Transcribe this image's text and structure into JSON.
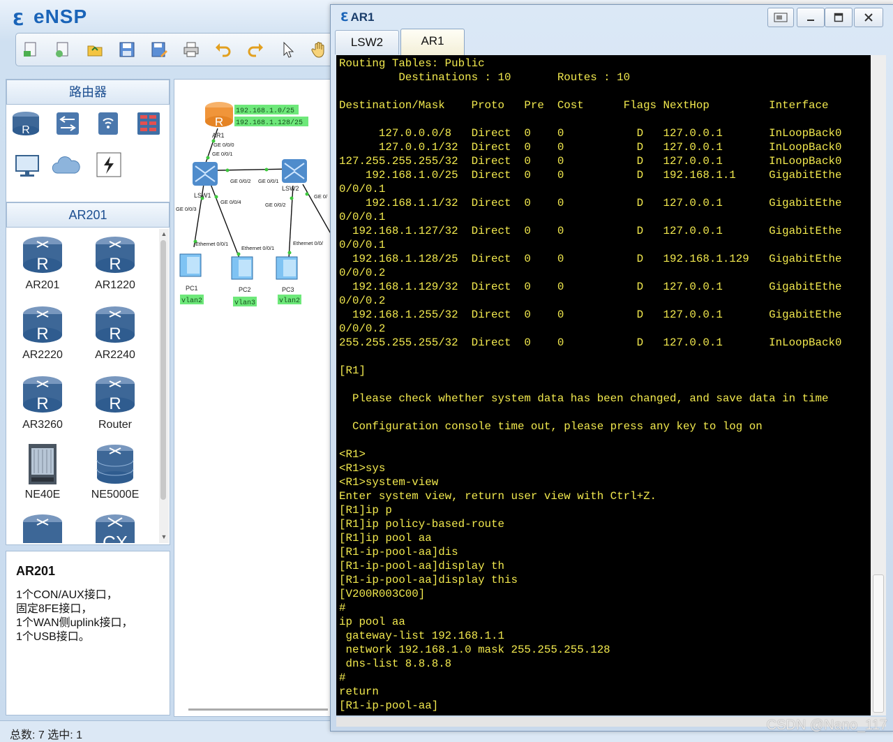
{
  "app": {
    "title": "eNSP"
  },
  "toolbar": {
    "buttons": [
      "new-topology-icon",
      "new-example-icon",
      "open-icon",
      "save-icon",
      "save-as-icon",
      "print-icon",
      "undo-icon",
      "redo-icon",
      "select-icon",
      "pan-hand-icon"
    ]
  },
  "left_panel": {
    "category_header": "路由器",
    "category_icons": [
      "router-category-icon",
      "switch-category-icon",
      "wireless-category-icon",
      "firewall-category-icon",
      "pc-category-icon",
      "cloud-category-icon",
      "connection-category-icon"
    ],
    "device_header": "AR201",
    "devices": [
      {
        "label": "AR201",
        "icon": "router-icon"
      },
      {
        "label": "AR1220",
        "icon": "router-icon"
      },
      {
        "label": "AR2220",
        "icon": "router-icon"
      },
      {
        "label": "AR2240",
        "icon": "router-icon"
      },
      {
        "label": "AR3260",
        "icon": "router-icon"
      },
      {
        "label": "Router",
        "icon": "router-icon"
      },
      {
        "label": "NE40E",
        "icon": "chassis-icon"
      },
      {
        "label": "NE5000E",
        "icon": "router-stack-icon"
      }
    ],
    "description": {
      "title": "AR201",
      "lines": [
        "1个CON/AUX接口，",
        "固定8FE接口，",
        "1个WAN侧uplink接口，",
        "1个USB接口。"
      ]
    }
  },
  "topology": {
    "nodes": {
      "ar1": "AR1",
      "lsw1": "LSW1",
      "lsw2": "LSW2",
      "pc1": "PC1",
      "pc2": "PC2",
      "pc3": "PC3"
    },
    "ip_labels": [
      "192.168.1.0/25",
      "192.168.1.128/25"
    ],
    "port_labels": {
      "ar1_ge000": "GE 0/0/0",
      "lsw1_ge001": "GE 0/0/1",
      "lsw1_ge002": "GE 0/0/2",
      "lsw2_ge001": "GE 0/0/1",
      "lsw1_ge003": "GE 0/0/3",
      "lsw1_ge004": "GE 0/0/4",
      "lsw2_ge002": "GE 0/0/2",
      "lsw2_ge0": "GE 0/",
      "pc1_eth": "Ethernet 0/0/1",
      "pc2_eth": "Ethernet 0/0/1",
      "pc3_eth": "Ethernet 0/0/"
    },
    "vlan_labels": {
      "pc1": "vlan2",
      "pc2": "vlan3",
      "pc3": "vlan2"
    }
  },
  "status_bar": {
    "text": "总数: 7 选中: 1"
  },
  "watermark": "CSDN @Nano_117",
  "ar1_window": {
    "title": "AR1",
    "tabs": [
      "LSW2",
      "AR1"
    ],
    "active_tab": "AR1",
    "terminal_lines": [
      "Routing Tables: Public",
      "         Destinations : 10       Routes : 10",
      "",
      "Destination/Mask    Proto   Pre  Cost      Flags NextHop         Interface",
      "",
      "      127.0.0.0/8   Direct  0    0           D   127.0.0.1       InLoopBack0",
      "      127.0.0.1/32  Direct  0    0           D   127.0.0.1       InLoopBack0",
      "127.255.255.255/32  Direct  0    0           D   127.0.0.1       InLoopBack0",
      "    192.168.1.0/25  Direct  0    0           D   192.168.1.1     GigabitEthe",
      "0/0/0.1",
      "    192.168.1.1/32  Direct  0    0           D   127.0.0.1       GigabitEthe",
      "0/0/0.1",
      "  192.168.1.127/32  Direct  0    0           D   127.0.0.1       GigabitEthe",
      "0/0/0.1",
      "  192.168.1.128/25  Direct  0    0           D   192.168.1.129   GigabitEthe",
      "0/0/0.2",
      "  192.168.1.129/32  Direct  0    0           D   127.0.0.1       GigabitEthe",
      "0/0/0.2",
      "  192.168.1.255/32  Direct  0    0           D   127.0.0.1       GigabitEthe",
      "0/0/0.2",
      "255.255.255.255/32  Direct  0    0           D   127.0.0.1       InLoopBack0",
      "",
      "[R1]",
      "",
      "  Please check whether system data has been changed, and save data in time",
      "",
      "  Configuration console time out, please press any key to log on",
      "",
      "<R1>",
      "<R1>sys",
      "<R1>system-view",
      "Enter system view, return user view with Ctrl+Z.",
      "[R1]ip p",
      "[R1]ip policy-based-route",
      "[R1]ip pool aa",
      "[R1-ip-pool-aa]dis",
      "[R1-ip-pool-aa]display th",
      "[R1-ip-pool-aa]display this",
      "[V200R003C00]",
      "#",
      "ip pool aa",
      " gateway-list 192.168.1.1",
      " network 192.168.1.0 mask 255.255.255.128",
      " dns-list 8.8.8.8",
      "#",
      "return",
      "[R1-ip-pool-aa]"
    ]
  },
  "colors": {
    "terminal_text": "#f2e94e",
    "terminal_bg": "#000000",
    "ip_label_bg": "#6ee87a",
    "router_orange": "#f0953a",
    "device_blue": "#2f5c8f"
  }
}
